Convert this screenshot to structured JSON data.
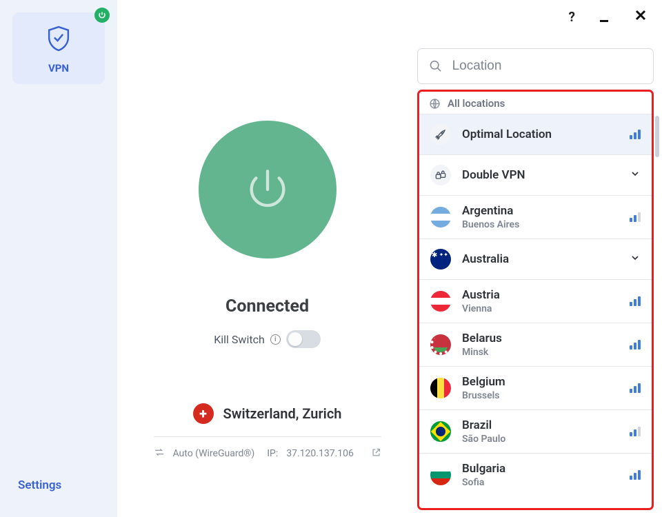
{
  "sidebar": {
    "vpn_label": "VPN",
    "settings_label": "Settings"
  },
  "titlebar": {
    "help": "?",
    "minimize": "—",
    "close": "✕"
  },
  "status": {
    "connected_label": "Connected",
    "killswitch_label": "Kill Switch",
    "current_location": "Switzerland, Zurich",
    "protocol_label": "Auto (WireGuard®)",
    "ip_label": "IP:",
    "ip_value": "37.120.137.106"
  },
  "search": {
    "placeholder": "Location"
  },
  "locations": {
    "header_label": "All locations",
    "items": [
      {
        "name": "Optimal Location",
        "city": "",
        "icon": "rocket",
        "signal": 3,
        "signal_off": 0,
        "selected": true
      },
      {
        "name": "Double VPN",
        "city": "",
        "icon": "double-lock",
        "expandable": true
      },
      {
        "name": "Argentina",
        "city": "Buenos Aires",
        "flag": "argentina",
        "signal": 2,
        "signal_off": 1
      },
      {
        "name": "Australia",
        "city": "",
        "flag": "australia",
        "expandable": true
      },
      {
        "name": "Austria",
        "city": "Vienna",
        "flag": "austria",
        "signal": 3,
        "signal_off": 0
      },
      {
        "name": "Belarus",
        "city": "Minsk",
        "flag": "belarus",
        "signal": 3,
        "signal_off": 0
      },
      {
        "name": "Belgium",
        "city": "Brussels",
        "flag": "belgium",
        "signal": 3,
        "signal_off": 0
      },
      {
        "name": "Brazil",
        "city": "São Paulo",
        "flag": "brazil",
        "signal": 2,
        "signal_off": 1
      },
      {
        "name": "Bulgaria",
        "city": "Sofia",
        "flag": "bulgaria",
        "signal": 3,
        "signal_off": 0
      }
    ]
  }
}
